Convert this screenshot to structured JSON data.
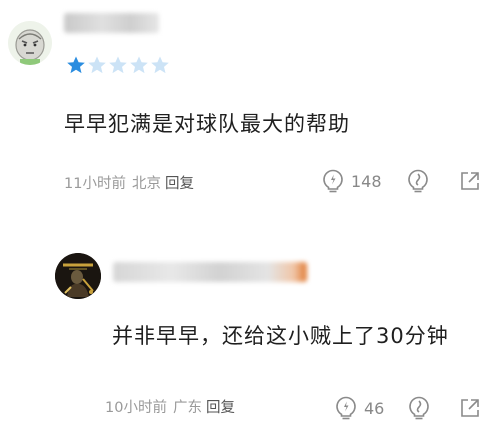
{
  "comments": [
    {
      "avatar_icon": "cartoon-face-avatar",
      "rating": 1,
      "rating_max": 5,
      "text": "早早犯满是对球队最大的帮助",
      "time": "11小时前",
      "location": "北京",
      "reply_label": "回复",
      "likes": "148"
    },
    {
      "avatar_icon": "dark-figure-avatar",
      "text": "并非早早，还给这小贼上了30分钟",
      "time": "10小时前",
      "location": "广东",
      "reply_label": "回复",
      "likes": "46"
    }
  ],
  "colors": {
    "star_filled": "#2a8de0",
    "star_empty": "#cce3f6",
    "meta_gray": "#9a9a9a",
    "icon_gray": "#8a8a8a"
  }
}
